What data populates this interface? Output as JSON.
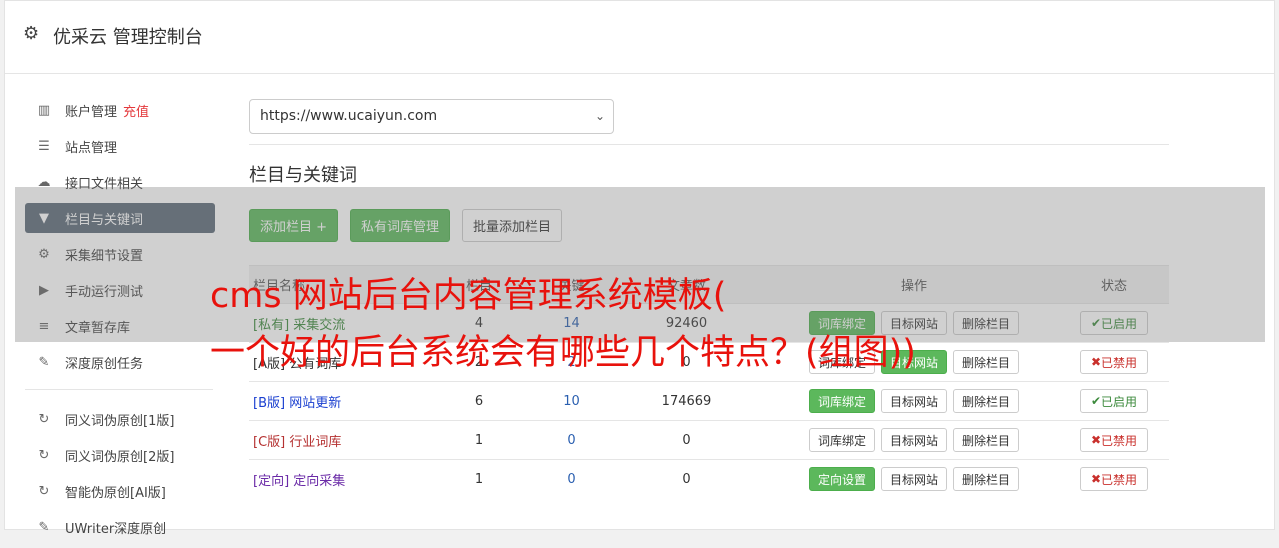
{
  "header": {
    "title": "优采云 管理控制台"
  },
  "sidebar": {
    "items": [
      {
        "icon": "bar-chart-icon",
        "label": "账户管理",
        "extra": "充值"
      },
      {
        "icon": "server-icon",
        "label": "站点管理"
      },
      {
        "icon": "cloud-upload-icon",
        "label": "接口文件相关"
      },
      {
        "icon": "filter-icon",
        "label": "栏目与关键词",
        "active": true
      },
      {
        "icon": "gears-icon",
        "label": "采集细节设置"
      },
      {
        "icon": "play-circle-icon",
        "label": "手动运行测试"
      },
      {
        "icon": "database-icon",
        "label": "文章暂存库"
      },
      {
        "icon": "edit-icon",
        "label": "深度原创任务"
      }
    ],
    "items2": [
      {
        "icon": "refresh-icon",
        "label": "同义词伪原创[1版]"
      },
      {
        "icon": "refresh-icon",
        "label": "同义词伪原创[2版]"
      },
      {
        "icon": "refresh-icon",
        "label": "智能伪原创[AI版]"
      },
      {
        "icon": "edit-icon",
        "label": "UWriter深度原创"
      }
    ]
  },
  "main": {
    "site_select": "https://www.ucaiyun.com",
    "section_title": "栏目与关键词",
    "buttons": {
      "add": "添加栏目 +",
      "private": "私有词库管理",
      "batch": "批量添加栏目"
    },
    "table": {
      "headers": {
        "name": "栏目名称",
        "col2": "栏目",
        "col3": "关键",
        "col4": "文章数",
        "ops": "操作",
        "status": "状态"
      },
      "rows": [
        {
          "tag": "[私有]",
          "name": "采集交流",
          "a": "4",
          "b": "14",
          "c": "92460",
          "op1": "词库绑定",
          "op2": "目标网站",
          "op3": "删除栏目",
          "status": "已启用"
        },
        {
          "tag": "[A版]",
          "name": "公有词库",
          "a": "2",
          "b": "2",
          "c": "0",
          "op1": "词库绑定",
          "op2": "目标网站",
          "op3": "删除栏目",
          "status": "已禁用"
        },
        {
          "tag": "[B版]",
          "name": "网站更新",
          "a": "6",
          "b": "10",
          "c": "174669",
          "op1": "词库绑定",
          "op2": "目标网站",
          "op3": "删除栏目",
          "status": "已启用"
        },
        {
          "tag": "[C版]",
          "name": "行业词库",
          "a": "1",
          "b": "0",
          "c": "0",
          "op1": "词库绑定",
          "op2": "目标网站",
          "op3": "删除栏目",
          "status": "已禁用"
        },
        {
          "tag": "[定向]",
          "name": "定向采集",
          "a": "1",
          "b": "0",
          "c": "0",
          "op1": "定向设置",
          "op2": "目标网站",
          "op3": "删除栏目",
          "status": "已禁用"
        }
      ]
    }
  },
  "overlay": {
    "line1": "cms 网站后台内容管理系统模板(",
    "line2": "一个好的后台系统会有哪些几个特点？(组图))"
  },
  "colors": {
    "accent_green": "#5cb85c",
    "active_nav": "#5d6a79",
    "overlay_text": "#e8120c"
  }
}
